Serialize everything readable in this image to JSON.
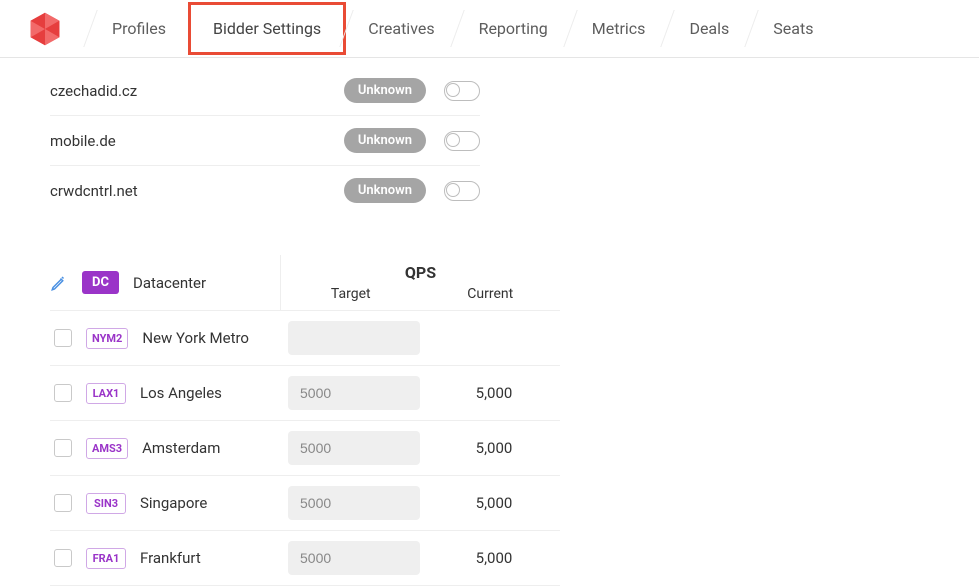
{
  "nav": {
    "tabs": [
      {
        "label": "Profiles"
      },
      {
        "label": "Bidder Settings",
        "highlighted": true
      },
      {
        "label": "Creatives"
      },
      {
        "label": "Reporting"
      },
      {
        "label": "Metrics"
      },
      {
        "label": "Deals"
      },
      {
        "label": "Seats"
      }
    ]
  },
  "domains": [
    {
      "name": "czechadid.cz",
      "status": "Unknown",
      "enabled": false
    },
    {
      "name": "mobile.de",
      "status": "Unknown",
      "enabled": false
    },
    {
      "name": "crwdcntrl.net",
      "status": "Unknown",
      "enabled": false
    }
  ],
  "datacenter_table": {
    "chip": "DC",
    "label": "Datacenter",
    "qps_title": "QPS",
    "target_label": "Target",
    "current_label": "Current",
    "rows": [
      {
        "code": "NYM2",
        "name": "New York Metro",
        "target_placeholder": "",
        "current": ""
      },
      {
        "code": "LAX1",
        "name": "Los Angeles",
        "target_placeholder": "5000",
        "current": "5,000"
      },
      {
        "code": "AMS3",
        "name": "Amsterdam",
        "target_placeholder": "5000",
        "current": "5,000"
      },
      {
        "code": "SIN3",
        "name": "Singapore",
        "target_placeholder": "5000",
        "current": "5,000"
      },
      {
        "code": "FRA1",
        "name": "Frankfurt",
        "target_placeholder": "5000",
        "current": "5,000"
      }
    ]
  }
}
